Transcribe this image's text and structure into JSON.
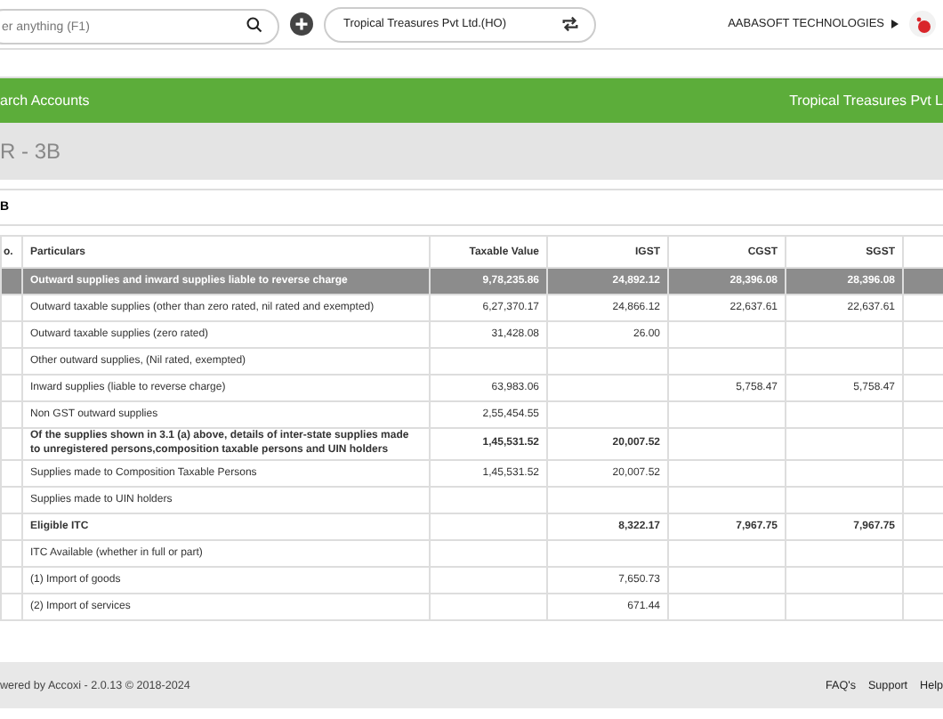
{
  "top_bar": {
    "search": {
      "placeholder": "er anything (F1)"
    },
    "company": "Tropical Treasures Pvt Ltd.(HO)",
    "user": "AABASOFT TECHNOLOGIES"
  },
  "menu_bar": {
    "left": "arch Accounts",
    "right": "Tropical Treasures Pvt L"
  },
  "page_title": "R - 3B",
  "section_title": "B",
  "table": {
    "columns": [
      "o.",
      "Particulars",
      "Taxable Value",
      "IGST",
      "CGST",
      "SGST"
    ],
    "rows": [
      {
        "kind": "highlight",
        "cells": [
          "",
          "Outward supplies and inward supplies liable to reverse charge",
          "9,78,235.86",
          "24,892.12",
          "28,396.08",
          "28,396.08"
        ]
      },
      {
        "kind": "normal",
        "cells": [
          "",
          "Outward taxable supplies (other than zero rated, nil rated and exempted)",
          "6,27,370.17",
          "24,866.12",
          "22,637.61",
          "22,637.61"
        ]
      },
      {
        "kind": "normal",
        "cells": [
          "",
          "Outward taxable supplies (zero rated)",
          "31,428.08",
          "26.00",
          "",
          ""
        ]
      },
      {
        "kind": "normal",
        "cells": [
          "",
          "Other outward supplies, (Nil rated, exempted)",
          "",
          "",
          "",
          ""
        ]
      },
      {
        "kind": "normal",
        "cells": [
          "",
          "Inward supplies (liable to reverse charge)",
          "63,983.06",
          "",
          "5,758.47",
          "5,758.47"
        ]
      },
      {
        "kind": "normal",
        "cells": [
          "",
          "Non GST outward supplies",
          "2,55,454.55",
          "",
          "",
          ""
        ]
      },
      {
        "kind": "bold",
        "cells": [
          "",
          "Of the supplies shown in 3.1 (a) above, details of inter-state supplies made to unregistered persons,composition taxable persons and UIN holders",
          "1,45,531.52",
          "20,007.52",
          "",
          ""
        ]
      },
      {
        "kind": "normal",
        "cells": [
          "",
          "Supplies made to Composition Taxable Persons",
          "1,45,531.52",
          "20,007.52",
          "",
          ""
        ]
      },
      {
        "kind": "normal",
        "cells": [
          "",
          "Supplies made to UIN holders",
          "",
          "",
          "",
          ""
        ]
      },
      {
        "kind": "bold",
        "cells": [
          "",
          "Eligible ITC",
          "",
          "8,322.17",
          "7,967.75",
          "7,967.75"
        ]
      },
      {
        "kind": "normal",
        "cells": [
          "",
          "ITC Available (whether in full or part)",
          "",
          "",
          "",
          ""
        ]
      },
      {
        "kind": "normal",
        "cells": [
          "",
          "(1) Import of goods",
          "",
          "7,650.73",
          "",
          ""
        ]
      },
      {
        "kind": "normal",
        "cells": [
          "",
          "(2) Import of services",
          "",
          "671.44",
          "",
          ""
        ]
      }
    ]
  },
  "footer": {
    "credit": "wered by Accoxi - 2.0.13 © 2018-2024",
    "links": [
      "FAQ's",
      "Support",
      "Help"
    ]
  }
}
